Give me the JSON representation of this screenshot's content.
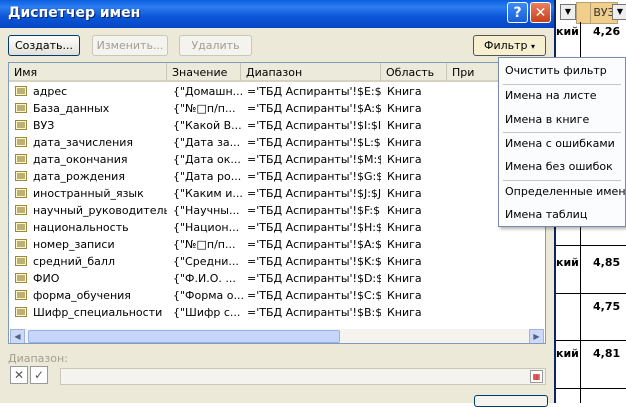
{
  "sheet": {
    "col_header": "ВУЗ",
    "values": [
      "4,26",
      "4,85",
      "4,75",
      "4,81"
    ],
    "partial_text": [
      "кий",
      "кий",
      "кий"
    ]
  },
  "dialog": {
    "title": "Диспетчер имен",
    "buttons": {
      "create": "Создать...",
      "edit": "Изменить...",
      "delete": "Удалить",
      "filter": "Фильтр"
    },
    "columns": [
      "Имя",
      "Значение",
      "Диапазон",
      "Область",
      "При"
    ],
    "rows": [
      {
        "name": "адрес",
        "value": "{\"Домашн...",
        "range": "='ТБД Аспиранты'!$E:$E",
        "scope": "Книга"
      },
      {
        "name": "База_данных",
        "value": "{\"№□п/п...",
        "range": "='ТБД Аспиранты'!$A:$M",
        "scope": "Книга"
      },
      {
        "name": "ВУЗ",
        "value": "{\"Какой В...",
        "range": "='ТБД Аспиранты'!$I:$I",
        "scope": "Книга"
      },
      {
        "name": "дата_зачисления",
        "value": "{\"Дата за...",
        "range": "='ТБД Аспиранты'!$L:$L",
        "scope": "Книга"
      },
      {
        "name": "дата_окончания",
        "value": "{\"Дата ок...",
        "range": "='ТБД Аспиранты'!$M:$M",
        "scope": "Книга"
      },
      {
        "name": "дата_рождения",
        "value": "{\"Дата ро...",
        "range": "='ТБД Аспиранты'!$G:$G",
        "scope": "Книга"
      },
      {
        "name": "иностранный_язык",
        "value": "{\"Каким и...",
        "range": "='ТБД Аспиранты'!$J:$J",
        "scope": "Книга"
      },
      {
        "name": "научный_руководитель",
        "value": "{\"Научны...",
        "range": "='ТБД Аспиранты'!$F:$F",
        "scope": "Книга"
      },
      {
        "name": "национальность",
        "value": "{\"Национ...",
        "range": "='ТБД Аспиранты'!$H:$H",
        "scope": "Книга"
      },
      {
        "name": "номер_записи",
        "value": "{\"№□п/п...",
        "range": "='ТБД Аспиранты'!$A:$A",
        "scope": "Книга"
      },
      {
        "name": "средний_балл",
        "value": "{\"Средни...",
        "range": "='ТБД Аспиранты'!$K:$K",
        "scope": "Книга"
      },
      {
        "name": "ФИО",
        "value": "{\"Ф.И.О. ...",
        "range": "='ТБД Аспиранты'!$D:$D",
        "scope": "Книга"
      },
      {
        "name": "форма_обучения",
        "value": "{\"Форма о...",
        "range": "='ТБД Аспиранты'!$C:$C",
        "scope": "Книга"
      },
      {
        "name": "Шифр_специальности",
        "value": "{\"Шифр с...",
        "range": "='ТБД Аспиранты'!$B:$B",
        "scope": "Книга"
      }
    ],
    "range_label": "Диапазон:",
    "range_value": ""
  },
  "filter_menu": {
    "items": [
      "Очистить фильтр",
      "Имена на листе",
      "Имена в книге",
      "Имена с ошибками",
      "Имена без ошибок",
      "Определенные имена",
      "Имена таблиц"
    ]
  },
  "colors": {
    "title_bar": "#0a5fe0",
    "dialog_bg": "#ece9d8",
    "header_bg": "#f2ce8c"
  }
}
